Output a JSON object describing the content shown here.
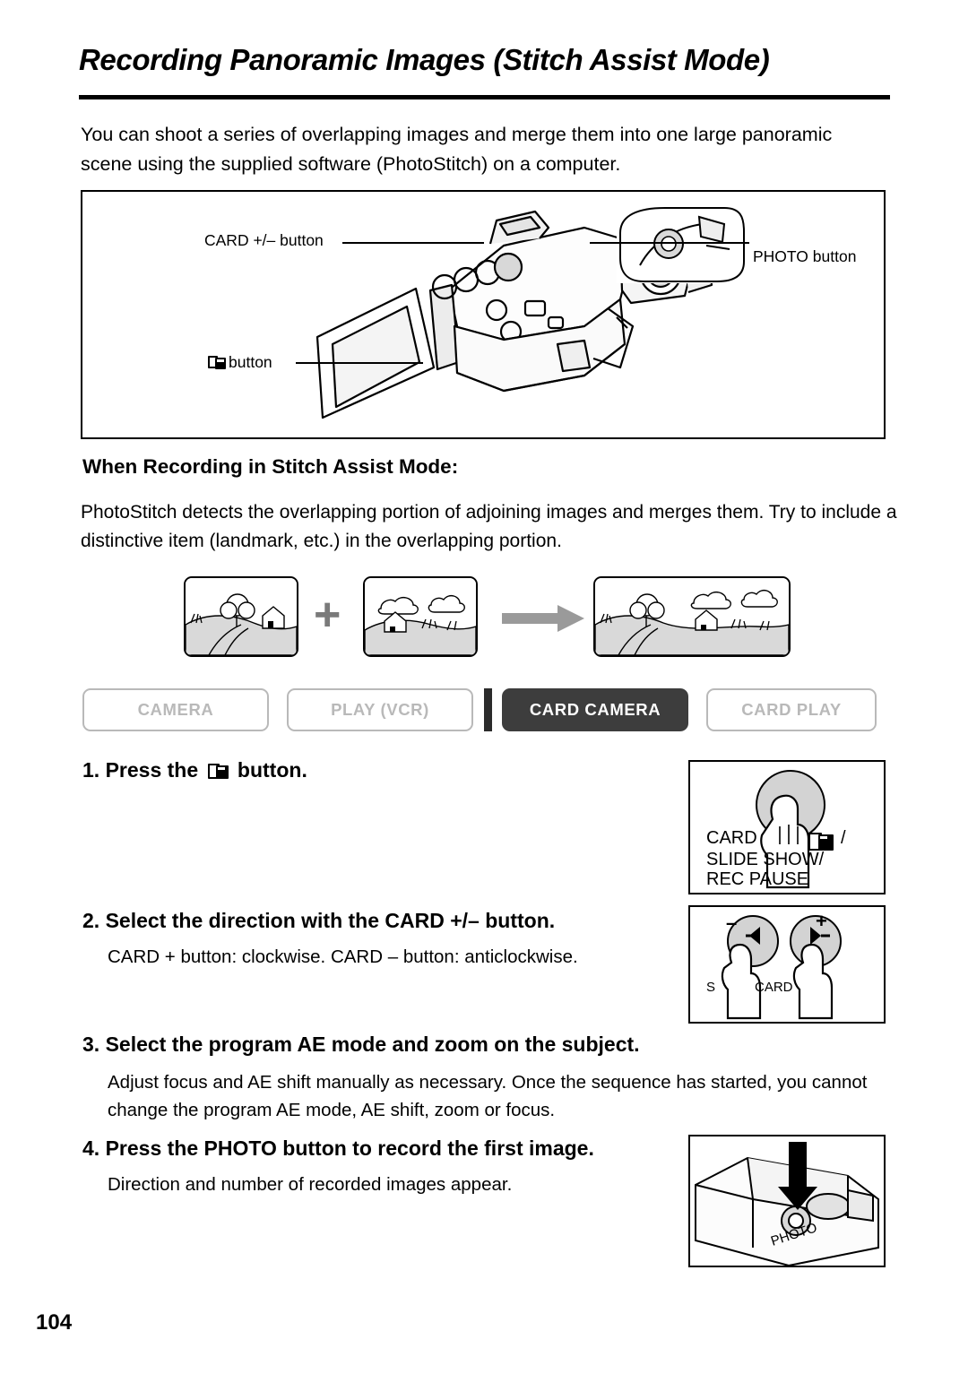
{
  "page": {
    "title": "Recording Panoramic Images (Stitch Assist Mode)",
    "number": "104",
    "intro": "You can shoot a series of overlapping images and merge them into one large panoramic scene using the supplied software (PhotoStitch) on a computer."
  },
  "figure": {
    "label_card": "CARD +/– button",
    "label_photo": "PHOTO button",
    "label_stitch_button": "button"
  },
  "section": {
    "heading": "When Recording in Stitch Assist Mode:",
    "paragraph": "PhotoStitch detects the overlapping portion of adjoining images and merges them. Try to include a distinctive item (landmark, etc.) in the overlapping portion.",
    "plus_sign": "+"
  },
  "mode_tabs": [
    {
      "label": "CAMERA",
      "active": false
    },
    {
      "label": "PLAY (VCR)",
      "active": false
    },
    {
      "label": "CARD CAMERA",
      "active": true
    },
    {
      "label": "CARD PLAY",
      "active": false
    }
  ],
  "steps": [
    {
      "number": "1.",
      "heading_prefix": "Press the",
      "heading_suffix": "button.",
      "body": ""
    },
    {
      "number": "2.",
      "heading": "Select the direction with the CARD +/– button.",
      "body": "CARD + button: clockwise. CARD – button: anticlockwise."
    },
    {
      "number": "3.",
      "heading": "Select the program AE mode and zoom on the subject.",
      "body": "Adjust focus and AE shift manually as necessary. Once the sequence has started, you cannot change the program AE mode, AE shift, zoom or focus."
    },
    {
      "number": "4.",
      "heading": "Press the PHOTO button to record the first image.",
      "body": "Direction and number of recorded images appear."
    }
  ],
  "illustrations": {
    "card_slideshow": {
      "line1": "CARD",
      "line2": "SLIDE SHOW/",
      "line3": "REC PAUSE",
      "slash": "/"
    },
    "card_buttons": {
      "minus": "–",
      "plus": "+",
      "label_left": "S",
      "label_right": "CARD"
    },
    "photo_button": {
      "label": "PHOTO"
    }
  },
  "colors": {
    "active_tab_bg": "#3d3d3d",
    "inactive_tab": "#b9b9b9",
    "ink": "#000000",
    "arrow_gray": "#9a9a9a"
  }
}
